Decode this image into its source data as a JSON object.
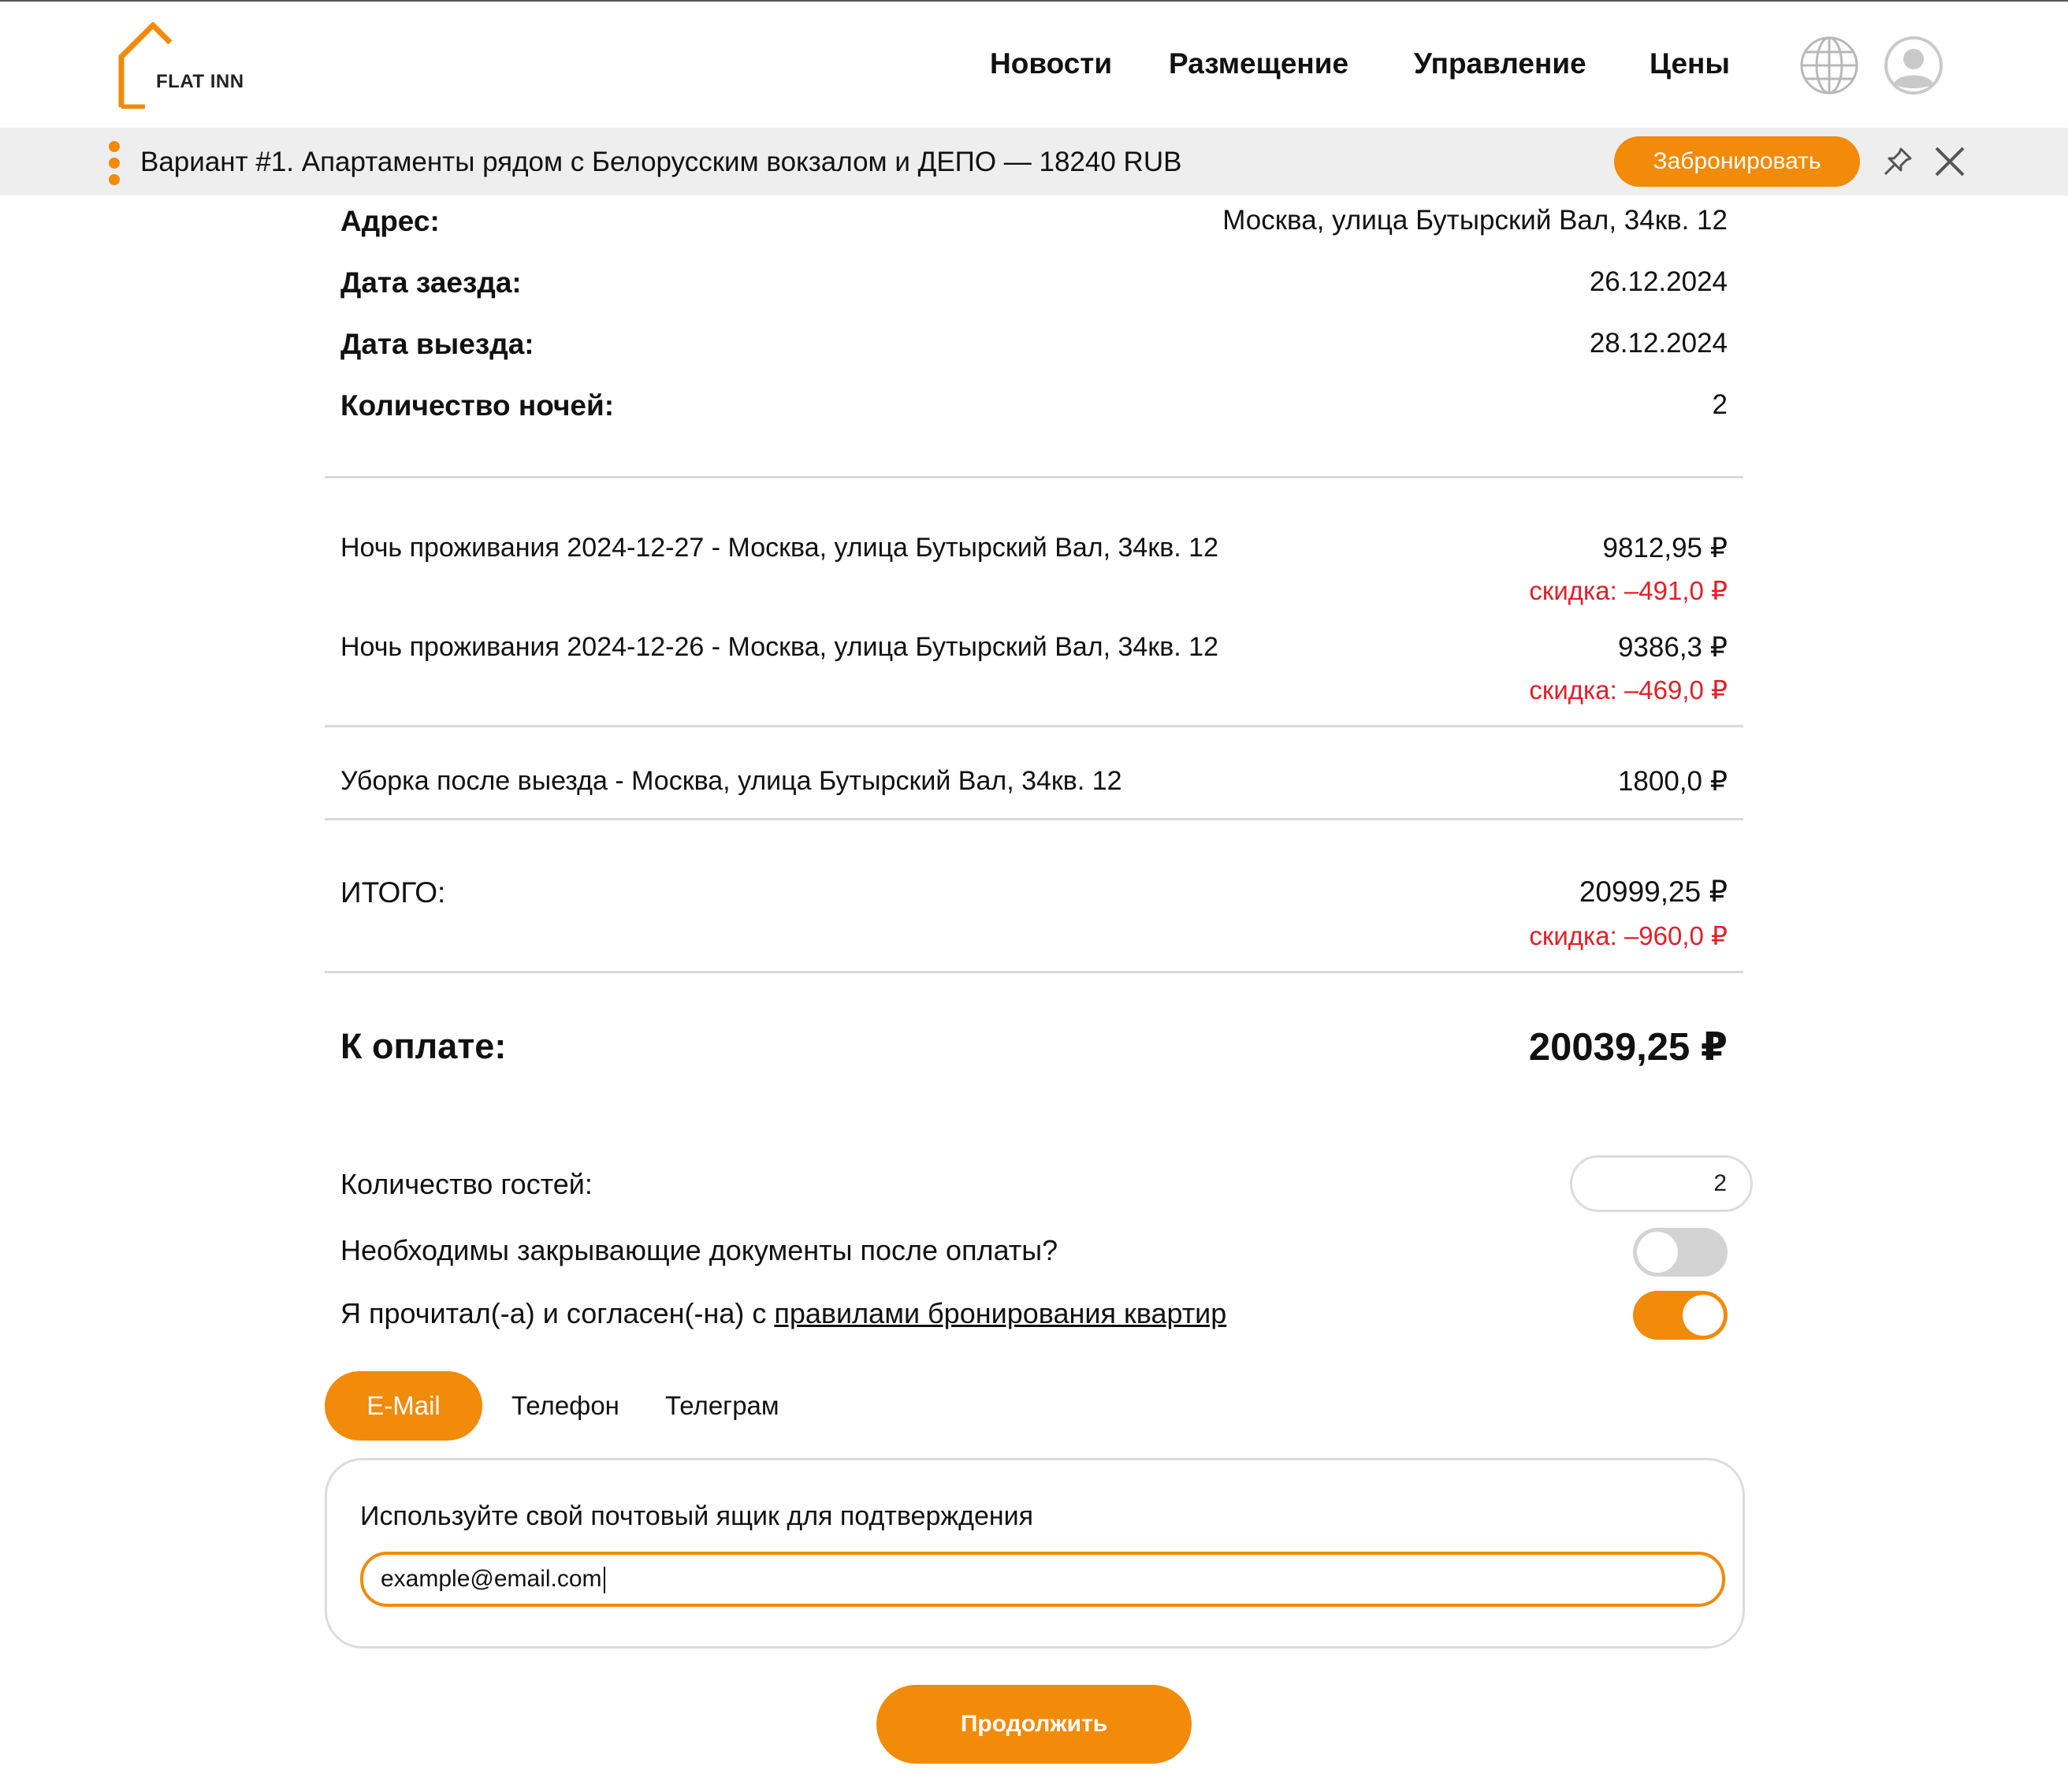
{
  "header": {
    "logo_text": "FLAT INN",
    "nav": [
      "Новости",
      "Размещение",
      "Управление",
      "Цены"
    ],
    "icons": {
      "language": "globe-icon",
      "profile": "avatar-icon"
    }
  },
  "variant_bar": {
    "title": "Вариант #1. Апартаменты рядом с Белорусским вокзалом и ДЕПО — 18240 RUB",
    "book_label": "Забронировать"
  },
  "details": {
    "address_label": "Адрес:",
    "address_value": "Москва, улица Бутырский Вал, 34кв. 12",
    "checkin_label": "Дата заезда:",
    "checkin_value": "26.12.2024",
    "checkout_label": "Дата выезда:",
    "checkout_value": "28.12.2024",
    "nights_label": "Количество ночей:",
    "nights_value": "2"
  },
  "lines": [
    {
      "desc": "Ночь проживания 2024-12-27 - Москва, улица Бутырский Вал, 34кв. 12",
      "amount": "9812,95 ₽",
      "discount": "скидка: –491,0 ₽"
    },
    {
      "desc": "Ночь проживания 2024-12-26 - Москва, улица Бутырский Вал, 34кв. 12",
      "amount": "9386,3 ₽",
      "discount": "скидка: –469,0 ₽"
    }
  ],
  "cleaning": {
    "desc": "Уборка после выезда - Москва, улица Бутырский Вал, 34кв. 12",
    "amount": "1800,0 ₽"
  },
  "total": {
    "label": "ИТОГО:",
    "amount": "20999,25 ₽",
    "discount": "скидка: –960,0 ₽"
  },
  "payment": {
    "label": "К оплате:",
    "amount": "20039,25 ₽"
  },
  "form": {
    "guests_label": "Количество гостей:",
    "guests_value": "2",
    "docs_label": "Необходимы закрывающие документы после оплаты?",
    "docs_on": false,
    "agree_prefix": "Я прочитал(-а) и согласен(-на) с ",
    "agree_link": "правилами бронирования квартир",
    "agree_on": true
  },
  "contact_tabs": [
    "E-Mail",
    "Телефон",
    "Телеграм"
  ],
  "active_tab": 0,
  "email": {
    "hint": "Используйте свой почтовый ящик для подтверждения",
    "value": "example@email.com"
  },
  "continue_label": "Продолжить",
  "colors": {
    "accent": "#f28a0a",
    "discount": "#e2202a",
    "divider": "#d9d9d9"
  }
}
